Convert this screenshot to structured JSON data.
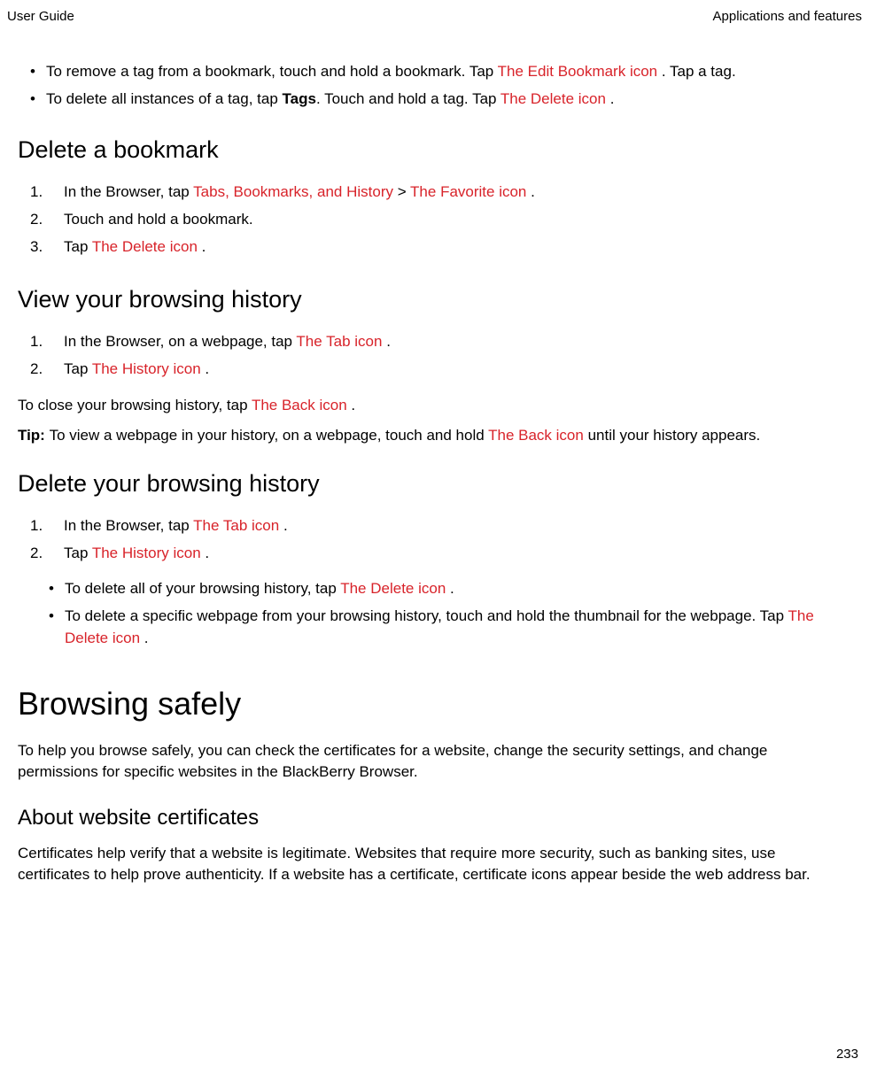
{
  "header": {
    "left": "User Guide",
    "right": "Applications and features"
  },
  "top_bullets": {
    "b1": {
      "p1": "To remove a tag from a bookmark, touch and hold a bookmark. Tap ",
      "link1": " The Edit Bookmark icon ",
      "p2": ". Tap a tag."
    },
    "b2": {
      "p1": "To delete all instances of a tag, tap ",
      "bold": "Tags",
      "p2": ". Touch and hold a tag. Tap ",
      "link1": " The Delete icon ",
      "p3": "."
    }
  },
  "sec_del_bm": {
    "title": "Delete a bookmark",
    "s1": {
      "p1": "In the Browser, tap ",
      "link1": " Tabs, Bookmarks, and History ",
      "sep": " > ",
      "link2": " The Favorite icon ",
      "p2": "."
    },
    "s2": {
      "p1": "Touch and hold a bookmark."
    },
    "s3": {
      "p1": "Tap ",
      "link1": " The Delete icon ",
      "p2": "."
    }
  },
  "sec_view_hist": {
    "title": "View your browsing history",
    "s1": {
      "p1": "In the Browser, on a webpage, tap ",
      "link1": " The Tab icon ",
      "p2": "."
    },
    "s2": {
      "p1": "Tap ",
      "link1": " The History icon ",
      "p2": "."
    },
    "close": {
      "p1": "To close your browsing history, tap ",
      "link1": " The Back icon ",
      "p2": "."
    },
    "tip": {
      "label": "Tip: ",
      "p1": "To view a webpage in your history, on a webpage, touch and hold ",
      "link1": " The Back icon ",
      "p2": " until your history appears."
    }
  },
  "sec_del_hist": {
    "title": "Delete your browsing history",
    "s1": {
      "p1": "In the Browser, tap ",
      "link1": " The Tab icon ",
      "p2": "."
    },
    "s2": {
      "p1": "Tap ",
      "link1": " The History icon ",
      "p2": "."
    },
    "n1": {
      "p1": "To delete all of your browsing history, tap ",
      "link1": " The Delete icon ",
      "p2": "."
    },
    "n2": {
      "p1": "To delete a specific webpage from your browsing history, touch and hold the thumbnail for the webpage. Tap ",
      "link1": " The Delete icon ",
      "p2": "."
    }
  },
  "sec_browsing_safely": {
    "title": "Browsing safely",
    "para": "To help you browse safely, you can check the certificates for a website, change the security settings, and change permissions for specific websites in the BlackBerry Browser."
  },
  "sec_certs": {
    "title": "About website certificates",
    "para": "Certificates help verify that a website is legitimate. Websites that require more security, such as banking sites, use certificates to help prove authenticity. If a website has a certificate, certificate icons appear beside the web address bar."
  },
  "page_number": "233"
}
